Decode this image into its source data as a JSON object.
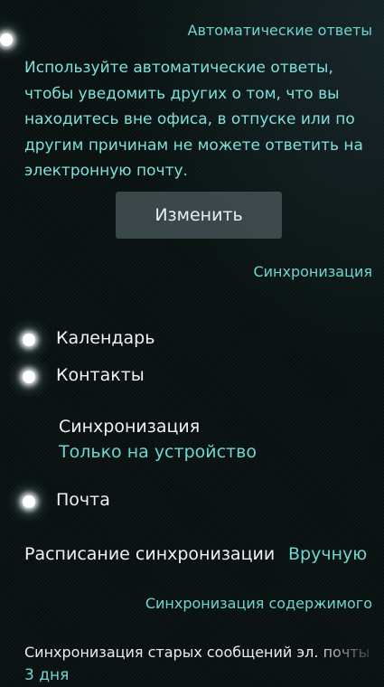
{
  "auto_replies": {
    "header": "Автоматические ответы",
    "description": "Используйте автоматические ответы, чтобы уведомить других о том, что вы находитесь вне офиса, в отпуске или по другим причинам не можете ответить на электронную почту.",
    "edit_label": "Изменить"
  },
  "sync": {
    "header": "Синхронизация",
    "calendar_label": "Календарь",
    "contacts_label": "Контакты",
    "contacts_sync_label": "Синхронизация",
    "contacts_sync_value": "Только на устройство",
    "mail_label": "Почта",
    "schedule_label": "Расписание синхронизации",
    "schedule_value": "Вручную"
  },
  "content_sync": {
    "header": "Синхронизация содержимого",
    "old_messages_label": "Синхронизация старых сообщений эл. почты",
    "old_messages_value": "3 дня"
  },
  "colors": {
    "accent": "#6fd6cf",
    "text": "#eef3f3",
    "background": "#07100f",
    "button": "#58686c"
  },
  "icons": {
    "switch_on": "glow-switch-on-icon"
  }
}
